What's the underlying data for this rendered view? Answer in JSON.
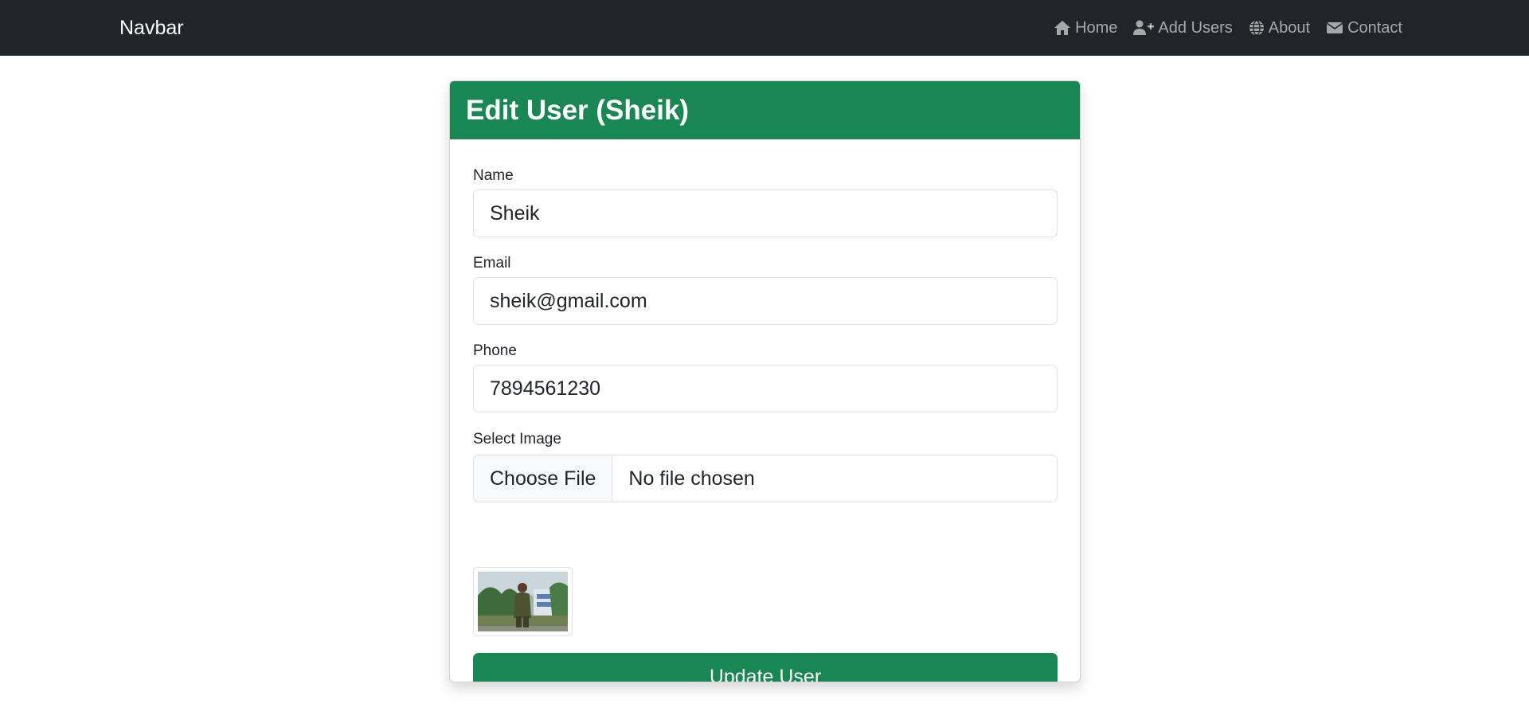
{
  "navbar": {
    "brand": "Navbar",
    "links": [
      {
        "label": "Home",
        "icon": "home-icon"
      },
      {
        "label": "Add Users",
        "icon": "user-plus-icon"
      },
      {
        "label": "About",
        "icon": "globe-icon"
      },
      {
        "label": "Contact",
        "icon": "envelope-icon"
      }
    ]
  },
  "card": {
    "title": "Edit User (Sheik)",
    "fields": {
      "name": {
        "label": "Name",
        "value": "Sheik"
      },
      "email": {
        "label": "Email",
        "value": "sheik@gmail.com"
      },
      "phone": {
        "label": "Phone",
        "value": "7894561230"
      },
      "image": {
        "label": "Select Image",
        "button": "Choose File",
        "status": "No file chosen"
      }
    },
    "submit_label": "Update User"
  },
  "colors": {
    "navbar_bg": "#212529",
    "accent": "#198754"
  }
}
